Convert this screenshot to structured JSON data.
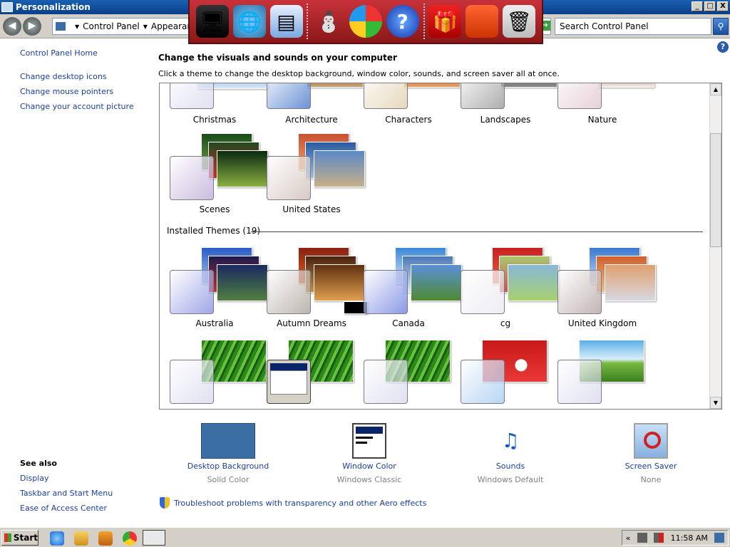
{
  "window": {
    "title": "Personalization",
    "controls": [
      "_",
      "□",
      "X"
    ]
  },
  "address": {
    "back_label": "◀",
    "forward_label": "▶",
    "crumbs": [
      "Control Panel",
      "Appearance an"
    ],
    "search_placeholder": "Search Control Panel"
  },
  "dock": {
    "icons": [
      "computer-icon",
      "network-globe-icon",
      "display-icon",
      "snowman-icon",
      "windows-orb-icon",
      "help-icon",
      "gift-icon",
      "folder-icon",
      "recycle-bin-icon"
    ]
  },
  "left_nav": {
    "links": [
      "Control Panel Home",
      "Change desktop icons",
      "Change mouse pointers",
      "Change your account picture"
    ]
  },
  "see_also": {
    "heading": "See also",
    "links": [
      "Display",
      "Taskbar and Start Menu",
      "Ease of Access Center"
    ]
  },
  "main": {
    "heading": "Change the visuals and sounds on your computer",
    "subheading": "Click a theme to change the desktop background, window color, sounds, and screen saver all at once."
  },
  "themes": {
    "online": [
      "Christmas",
      "Architecture",
      "Characters",
      "Landscapes",
      "Nature",
      "Scenes",
      "United States"
    ],
    "installed_label": "Installed Themes (19)",
    "installed": [
      "Australia",
      "Autumn Dreams",
      "Canada",
      "cg",
      "United Kingdom"
    ]
  },
  "settings": [
    {
      "name": "Desktop Background",
      "value": "Solid Color"
    },
    {
      "name": "Window Color",
      "value": "Windows Classic"
    },
    {
      "name": "Sounds",
      "value": "Windows Default"
    },
    {
      "name": "Screen Saver",
      "value": "None"
    }
  ],
  "troubleshoot": "Troubleshoot problems with transparency and other Aero effects",
  "taskbar": {
    "start_label": "Start",
    "clock": "11:58 AM",
    "tray_chevron": "«"
  },
  "colors": {
    "desktop_background": "#3a6ea5",
    "link": "#1a3f9a",
    "dock": "#b02830"
  }
}
